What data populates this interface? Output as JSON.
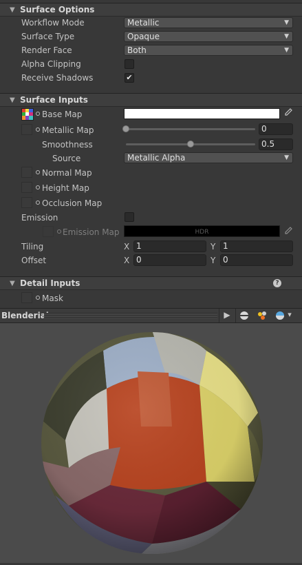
{
  "surface_options": {
    "title": "Surface Options",
    "workflow_mode": {
      "label": "Workflow Mode",
      "value": "Metallic"
    },
    "surface_type": {
      "label": "Surface Type",
      "value": "Opaque"
    },
    "render_face": {
      "label": "Render Face",
      "value": "Both"
    },
    "alpha_clipping": {
      "label": "Alpha Clipping",
      "checked": false
    },
    "receive_shadows": {
      "label": "Receive Shadows",
      "checked": true,
      "check_mark": "✔"
    }
  },
  "surface_inputs": {
    "title": "Surface Inputs",
    "base_map": {
      "label": "Base Map"
    },
    "metallic_map": {
      "label": "Metallic Map",
      "value": "0",
      "level": 0.0
    },
    "smoothness": {
      "label": "Smoothness",
      "value": "0.5",
      "level": 0.5
    },
    "source": {
      "label": "Source",
      "value": "Metallic Alpha"
    },
    "normal_map": {
      "label": "Normal Map"
    },
    "height_map": {
      "label": "Height Map"
    },
    "occlusion_map": {
      "label": "Occlusion Map"
    },
    "emission": {
      "label": "Emission",
      "checked": false
    },
    "emission_map": {
      "label": "Emission Map",
      "hdr_text": "HDR"
    },
    "tiling": {
      "label": "Tiling",
      "x_label": "X",
      "x": "1",
      "y_label": "Y",
      "y": "1"
    },
    "offset": {
      "label": "Offset",
      "x_label": "X",
      "x": "0",
      "y_label": "Y",
      "y": "0"
    }
  },
  "detail_inputs": {
    "title": "Detail Inputs",
    "help_icon": "?",
    "mask": {
      "label": "Mask"
    }
  },
  "preview": {
    "title": "Blenderial",
    "play_icon": "▶",
    "dropdown_arrow": "▾"
  },
  "colors": {
    "panel_bg": "#383838",
    "header_bg": "#3e3e3e",
    "preview_bg": "#4b4b4b",
    "base_map_color": "#ffffff"
  }
}
